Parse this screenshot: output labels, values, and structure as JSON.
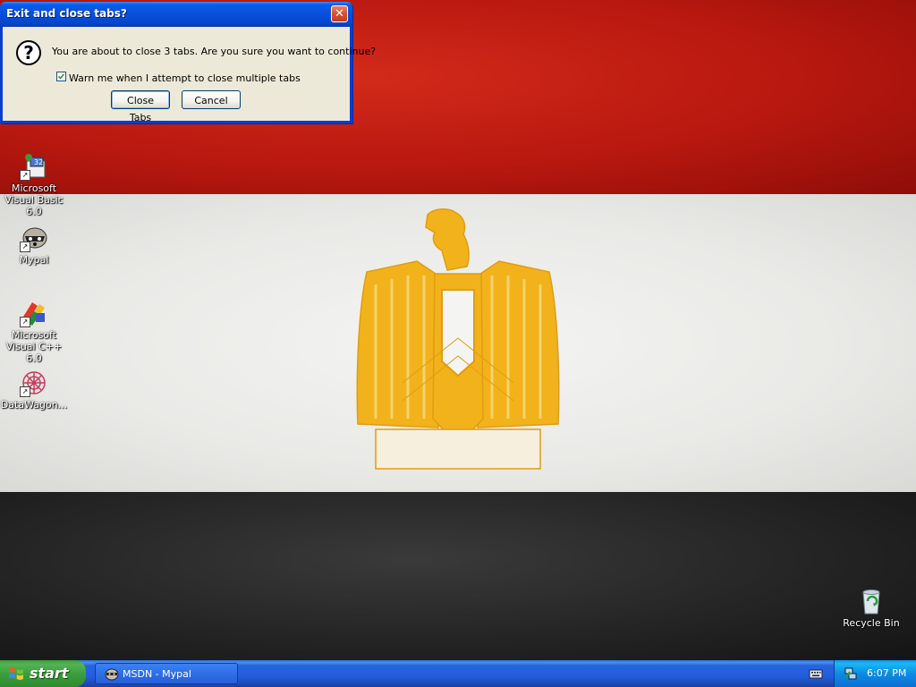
{
  "dialog": {
    "title": "Exit and close tabs?",
    "message": "You are about to close 3 tabs. Are you sure you want to continue?",
    "warn_checkbox_label": "Warn me when I attempt to close multiple tabs",
    "warn_checked": true,
    "close_tabs_label": "Close Tabs",
    "cancel_label": "Cancel"
  },
  "desktop": {
    "icons": [
      {
        "label": "Microsoft Visual Basic 6.0",
        "icon": "visual-basic-icon"
      },
      {
        "label": "Mypal",
        "icon": "mypal-raccoon-icon"
      },
      {
        "label": "Microsoft Visual C++ 6.0",
        "icon": "visual-cpp-icon"
      },
      {
        "label": "DataWagon...",
        "icon": "datawagon-icon"
      },
      {
        "label": "Recycle Bin",
        "icon": "recycle-bin-icon"
      }
    ],
    "wallpaper_colors": {
      "red": "#c0201a",
      "white": "#ececea",
      "black": "#222222",
      "emblem": "#f2b21c"
    }
  },
  "taskbar": {
    "start_label": "start",
    "task_item_label": "MSDN - Mypal",
    "clock": "6:07 PM"
  }
}
